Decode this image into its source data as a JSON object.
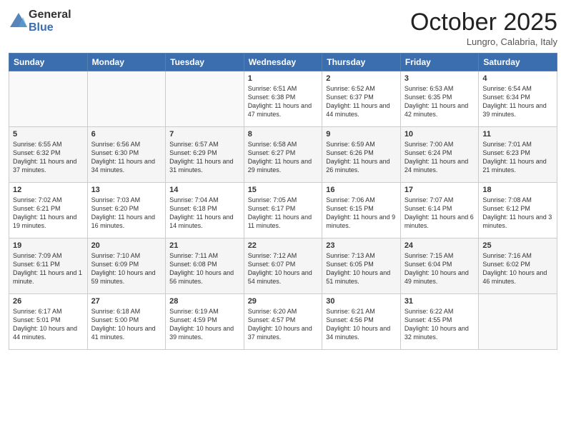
{
  "logo": {
    "line1": "General",
    "line2": "Blue"
  },
  "title": "October 2025",
  "subtitle": "Lungro, Calabria, Italy",
  "days_header": [
    "Sunday",
    "Monday",
    "Tuesday",
    "Wednesday",
    "Thursday",
    "Friday",
    "Saturday"
  ],
  "weeks": [
    [
      {
        "day": "",
        "text": ""
      },
      {
        "day": "",
        "text": ""
      },
      {
        "day": "",
        "text": ""
      },
      {
        "day": "1",
        "text": "Sunrise: 6:51 AM\nSunset: 6:38 PM\nDaylight: 11 hours and 47 minutes."
      },
      {
        "day": "2",
        "text": "Sunrise: 6:52 AM\nSunset: 6:37 PM\nDaylight: 11 hours and 44 minutes."
      },
      {
        "day": "3",
        "text": "Sunrise: 6:53 AM\nSunset: 6:35 PM\nDaylight: 11 hours and 42 minutes."
      },
      {
        "day": "4",
        "text": "Sunrise: 6:54 AM\nSunset: 6:34 PM\nDaylight: 11 hours and 39 minutes."
      }
    ],
    [
      {
        "day": "5",
        "text": "Sunrise: 6:55 AM\nSunset: 6:32 PM\nDaylight: 11 hours and 37 minutes."
      },
      {
        "day": "6",
        "text": "Sunrise: 6:56 AM\nSunset: 6:30 PM\nDaylight: 11 hours and 34 minutes."
      },
      {
        "day": "7",
        "text": "Sunrise: 6:57 AM\nSunset: 6:29 PM\nDaylight: 11 hours and 31 minutes."
      },
      {
        "day": "8",
        "text": "Sunrise: 6:58 AM\nSunset: 6:27 PM\nDaylight: 11 hours and 29 minutes."
      },
      {
        "day": "9",
        "text": "Sunrise: 6:59 AM\nSunset: 6:26 PM\nDaylight: 11 hours and 26 minutes."
      },
      {
        "day": "10",
        "text": "Sunrise: 7:00 AM\nSunset: 6:24 PM\nDaylight: 11 hours and 24 minutes."
      },
      {
        "day": "11",
        "text": "Sunrise: 7:01 AM\nSunset: 6:23 PM\nDaylight: 11 hours and 21 minutes."
      }
    ],
    [
      {
        "day": "12",
        "text": "Sunrise: 7:02 AM\nSunset: 6:21 PM\nDaylight: 11 hours and 19 minutes."
      },
      {
        "day": "13",
        "text": "Sunrise: 7:03 AM\nSunset: 6:20 PM\nDaylight: 11 hours and 16 minutes."
      },
      {
        "day": "14",
        "text": "Sunrise: 7:04 AM\nSunset: 6:18 PM\nDaylight: 11 hours and 14 minutes."
      },
      {
        "day": "15",
        "text": "Sunrise: 7:05 AM\nSunset: 6:17 PM\nDaylight: 11 hours and 11 minutes."
      },
      {
        "day": "16",
        "text": "Sunrise: 7:06 AM\nSunset: 6:15 PM\nDaylight: 11 hours and 9 minutes."
      },
      {
        "day": "17",
        "text": "Sunrise: 7:07 AM\nSunset: 6:14 PM\nDaylight: 11 hours and 6 minutes."
      },
      {
        "day": "18",
        "text": "Sunrise: 7:08 AM\nSunset: 6:12 PM\nDaylight: 11 hours and 3 minutes."
      }
    ],
    [
      {
        "day": "19",
        "text": "Sunrise: 7:09 AM\nSunset: 6:11 PM\nDaylight: 11 hours and 1 minute."
      },
      {
        "day": "20",
        "text": "Sunrise: 7:10 AM\nSunset: 6:09 PM\nDaylight: 10 hours and 59 minutes."
      },
      {
        "day": "21",
        "text": "Sunrise: 7:11 AM\nSunset: 6:08 PM\nDaylight: 10 hours and 56 minutes."
      },
      {
        "day": "22",
        "text": "Sunrise: 7:12 AM\nSunset: 6:07 PM\nDaylight: 10 hours and 54 minutes."
      },
      {
        "day": "23",
        "text": "Sunrise: 7:13 AM\nSunset: 6:05 PM\nDaylight: 10 hours and 51 minutes."
      },
      {
        "day": "24",
        "text": "Sunrise: 7:15 AM\nSunset: 6:04 PM\nDaylight: 10 hours and 49 minutes."
      },
      {
        "day": "25",
        "text": "Sunrise: 7:16 AM\nSunset: 6:02 PM\nDaylight: 10 hours and 46 minutes."
      }
    ],
    [
      {
        "day": "26",
        "text": "Sunrise: 6:17 AM\nSunset: 5:01 PM\nDaylight: 10 hours and 44 minutes."
      },
      {
        "day": "27",
        "text": "Sunrise: 6:18 AM\nSunset: 5:00 PM\nDaylight: 10 hours and 41 minutes."
      },
      {
        "day": "28",
        "text": "Sunrise: 6:19 AM\nSunset: 4:59 PM\nDaylight: 10 hours and 39 minutes."
      },
      {
        "day": "29",
        "text": "Sunrise: 6:20 AM\nSunset: 4:57 PM\nDaylight: 10 hours and 37 minutes."
      },
      {
        "day": "30",
        "text": "Sunrise: 6:21 AM\nSunset: 4:56 PM\nDaylight: 10 hours and 34 minutes."
      },
      {
        "day": "31",
        "text": "Sunrise: 6:22 AM\nSunset: 4:55 PM\nDaylight: 10 hours and 32 minutes."
      },
      {
        "day": "",
        "text": ""
      }
    ]
  ]
}
